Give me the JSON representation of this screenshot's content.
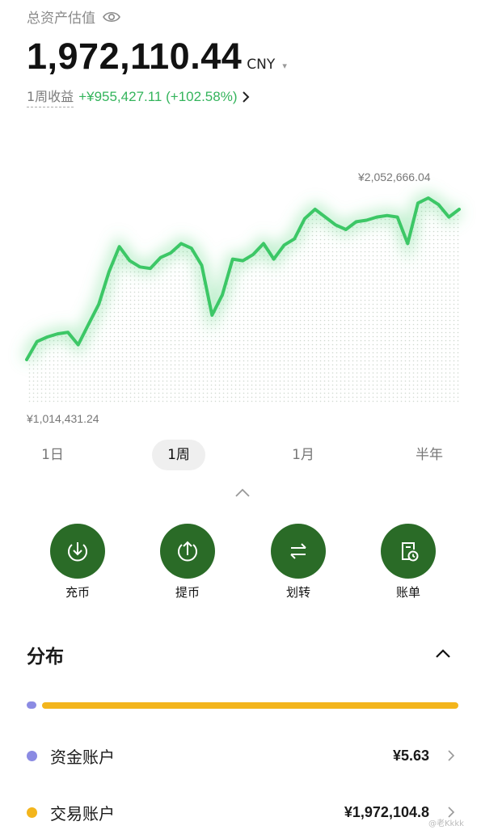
{
  "header": {
    "label": "总资产估值",
    "total_value": "1,972,110.44",
    "currency": "CNY",
    "weekly_label": "1周收益",
    "weekly_gain": "+¥955,427.11 (+102.58%)"
  },
  "chart": {
    "high_label": "¥2,052,666.04",
    "low_label": "¥1,014,431.24",
    "line_color": "#3cc766"
  },
  "chart_data": {
    "type": "line",
    "series": [
      {
        "values": [
          1014431,
          1130000,
          1160000,
          1180000,
          1190000,
          1110000,
          1240000,
          1370000,
          1580000,
          1740000,
          1650000,
          1610000,
          1600000,
          1670000,
          1700000,
          1760000,
          1730000,
          1620000,
          1300000,
          1430000,
          1660000,
          1650000,
          1690000,
          1760000,
          1660000,
          1750000,
          1790000,
          1920000,
          1980000,
          1930000,
          1880000,
          1850000,
          1900000,
          1910000,
          1930000,
          1940000,
          1930000,
          1760000,
          2020000,
          2052666,
          2010000,
          1930000,
          1980000
        ]
      }
    ],
    "max_label": "¥2,052,666.04",
    "min_label": "¥1,014,431.24"
  },
  "periods": [
    "1日",
    "1周",
    "1月",
    "半年"
  ],
  "active_period": "1周",
  "actions": [
    {
      "label": "充币",
      "icon": "deposit-icon"
    },
    {
      "label": "提币",
      "icon": "withdraw-icon"
    },
    {
      "label": "划转",
      "icon": "transfer-icon"
    },
    {
      "label": "账单",
      "icon": "bill-icon"
    }
  ],
  "distribution": {
    "title": "分布",
    "accounts": [
      {
        "name": "资金账户",
        "value": "¥5.63",
        "color": "#8b8be3"
      },
      {
        "name": "交易账户",
        "value": "¥1,972,104.8",
        "color": "#f3b51c"
      }
    ]
  },
  "colors": {
    "accent_green": "#2a6b27",
    "gain_green": "#34b45c",
    "bar_yellow": "#f3b51c",
    "bar_purple": "#8b8be3"
  },
  "watermark": "@老Kkkk"
}
